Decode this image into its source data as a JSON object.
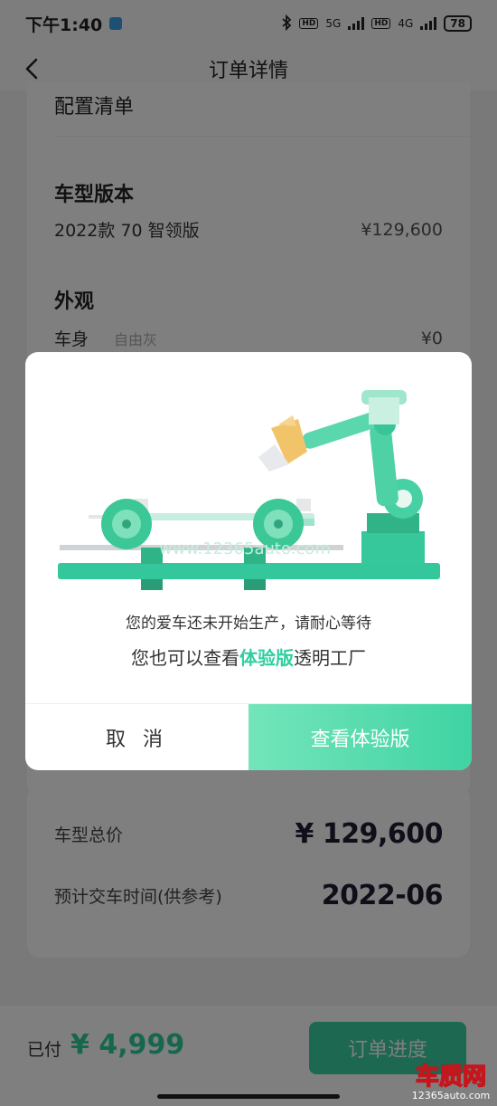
{
  "status_bar": {
    "time": "下午1:40",
    "network1": "5G",
    "network2": "4G",
    "hd": "HD",
    "battery": "78"
  },
  "header": {
    "title": "订单详情",
    "back_icon": "chevron-left-icon"
  },
  "config": {
    "heading": "配置清单",
    "model_section": "车型版本",
    "model_name": "2022款 70 智领版",
    "model_price": "¥129,600",
    "exterior_section": "外观",
    "body_label": "车身",
    "body_color": "自由灰",
    "body_price": "¥0"
  },
  "summary": {
    "total_label": "车型总价",
    "total_value": "¥ 129,600",
    "delivery_label": "预计交车时间(供参考)",
    "delivery_value": "2022-06"
  },
  "bottom_bar": {
    "paid_label": "已付",
    "paid_value": "¥ 4,999",
    "progress_button": "订单进度"
  },
  "dialog": {
    "message_line1": "您的爱车还未开始生产，请耐心等待",
    "message_line2_prefix": "您也可以查看",
    "message_line2_highlight": "体验版",
    "message_line2_suffix": "透明工厂",
    "cancel_button": "取 消",
    "view_button": "查看体验版",
    "illustration": "robot-arm-assembly-line-illustration"
  },
  "watermark": {
    "logo_text": "车质网",
    "logo_url_text": "12365auto.com",
    "overlay_text": "www.12365auto.com"
  },
  "colors": {
    "accent": "#2fcf9f",
    "accent_light": "#74e5bb",
    "dark_text": "#1c1f33"
  }
}
